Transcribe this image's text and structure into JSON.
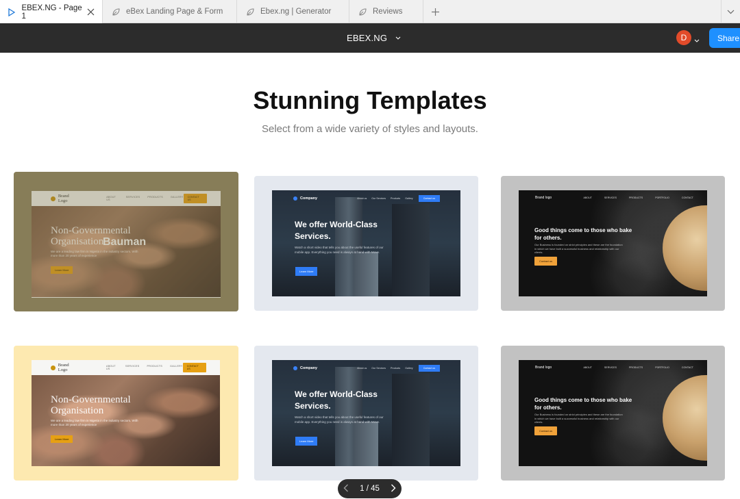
{
  "tabs": [
    {
      "label": "EBEX.NG - Page 1",
      "icon": "play-icon",
      "active": true
    },
    {
      "label": "eBex Landing Page & Form",
      "icon": "leaf-icon"
    },
    {
      "label": "Ebex.ng | Generator",
      "icon": "leaf-icon"
    },
    {
      "label": "Reviews",
      "icon": "leaf-icon"
    }
  ],
  "toolbar": {
    "doc_title": "EBEX.NG",
    "avatar_initial": "D",
    "share_label": "Share"
  },
  "main": {
    "heading": "Stunning Templates",
    "subheading": "Select from a wide variety of styles and layouts."
  },
  "templates": {
    "ngo": {
      "brand": "Brand Logo",
      "links": [
        "ABOUT US",
        "SERVICES",
        "PRODUCTS",
        "GALLERY"
      ],
      "cta": "CONTACT US",
      "title_line1": "Non-Governmental",
      "title_line2": "Organisation",
      "overlay_text": "Bauman",
      "desc": "We are a leading law firm in Nigeria in the industry sectors. With more than 20 years of experience",
      "button": "Learn More"
    },
    "company": {
      "brand": "Company",
      "links": [
        "About us",
        "Our Services",
        "Products",
        "Gallery"
      ],
      "cta": "Contact us",
      "title": "We offer World-Class Services.",
      "desc": "Watch a short video that tells you about the useful features of our mobile app. Everything you need is always at hand with Move.",
      "button": "Learn More"
    },
    "bakery": {
      "brand": "Brand logo",
      "links": [
        "ABOUT",
        "SERVICES",
        "PRODUCTS",
        "PORTFOLIO",
        "CONTACT"
      ],
      "title": "Good things come to those who bake for others.",
      "desc": "Our Business is founded on strict principles and these are the foundation in which we have built a successful business and relationship with our clients.",
      "button": "Contact us"
    }
  },
  "pager": {
    "label": "1 / 45"
  },
  "colors": {
    "toolbar_bg": "#2c2c2c",
    "share_blue": "#1e90ff",
    "avatar_red": "#e24b2a",
    "card_olive": "#8f8563",
    "card_yellow": "#fde9b0",
    "card_slate": "#e4e8ef",
    "card_gray": "#c2c2c2"
  }
}
